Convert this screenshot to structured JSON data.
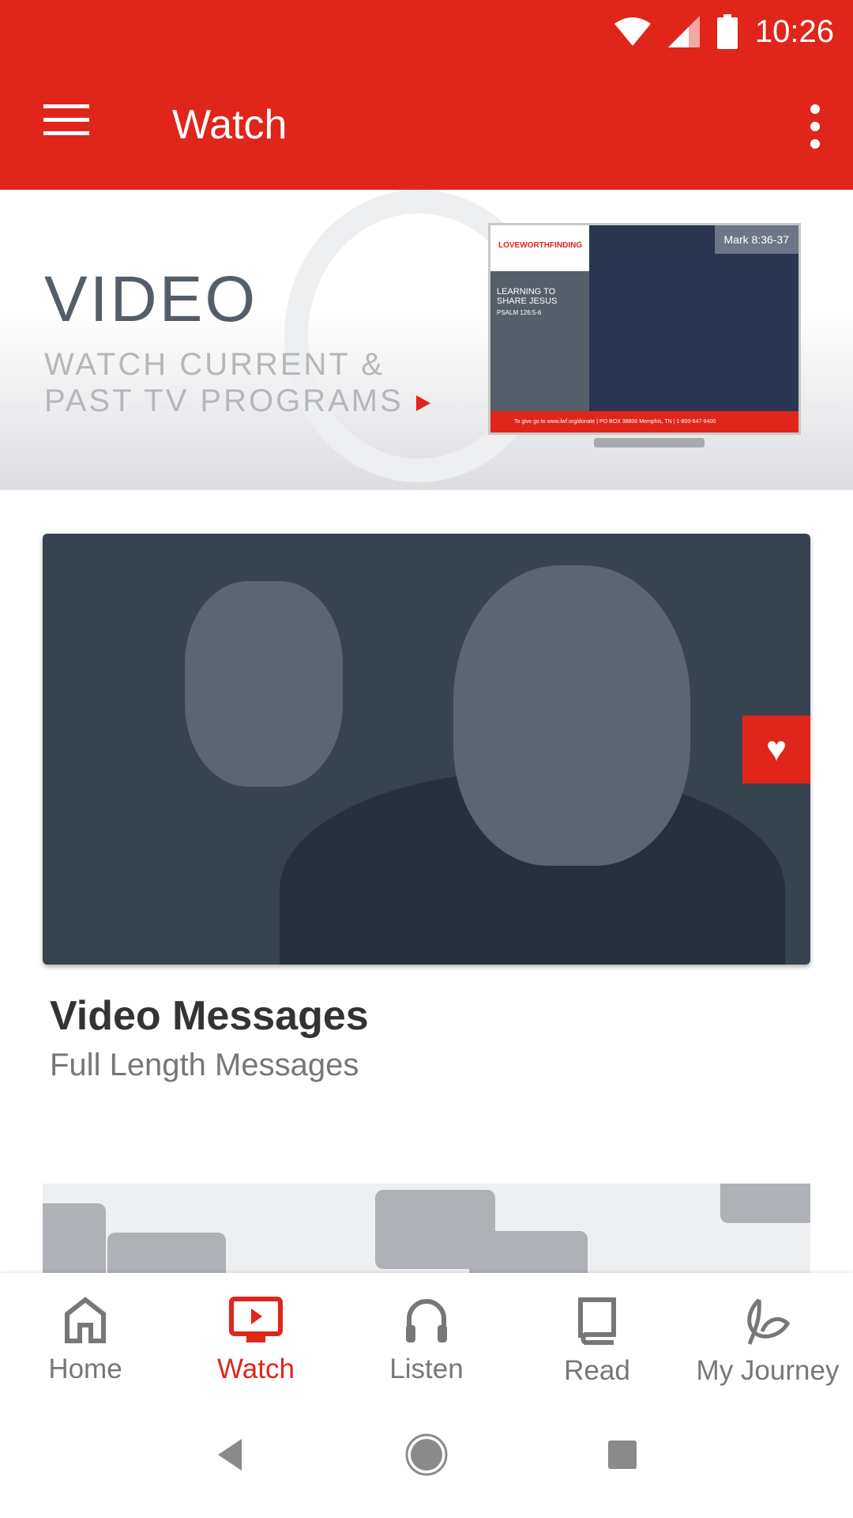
{
  "status_bar": {
    "time": "10:26",
    "icons": [
      "wifi-icon",
      "signal-icon",
      "battery-icon"
    ]
  },
  "app_bar": {
    "title": "Watch",
    "menu_icon": "hamburger-icon",
    "more_icon": "more-vert-icon"
  },
  "banner": {
    "heading": "VIDEO",
    "subtitle_line1": "WATCH CURRENT &",
    "subtitle_line2": "PAST TV PROGRAMS",
    "tv": {
      "logo": "LOVEWORTHFINDING",
      "sermon_title": "LEARNING TO SHARE JESUS",
      "scripture": "PSALM 126:5-6",
      "verse": "Mark 8:36-37",
      "footer": "To give go to www.lwf.org/donate | PO BOX 38800 Memphis, TN | 1-800-647-9400"
    }
  },
  "cards": [
    {
      "title": "Video Messages",
      "subtitle": "Full Length Messages"
    }
  ],
  "bottom_nav": {
    "items": [
      {
        "label": "Home",
        "icon": "home-icon"
      },
      {
        "label": "Watch",
        "icon": "tv-play-icon",
        "active": true
      },
      {
        "label": "Listen",
        "icon": "headphones-icon"
      },
      {
        "label": "Read",
        "icon": "book-icon"
      },
      {
        "label": "My Journey",
        "icon": "leaf-icon"
      }
    ]
  },
  "colors": {
    "accent": "#e0251b",
    "inactive": "#777777"
  }
}
